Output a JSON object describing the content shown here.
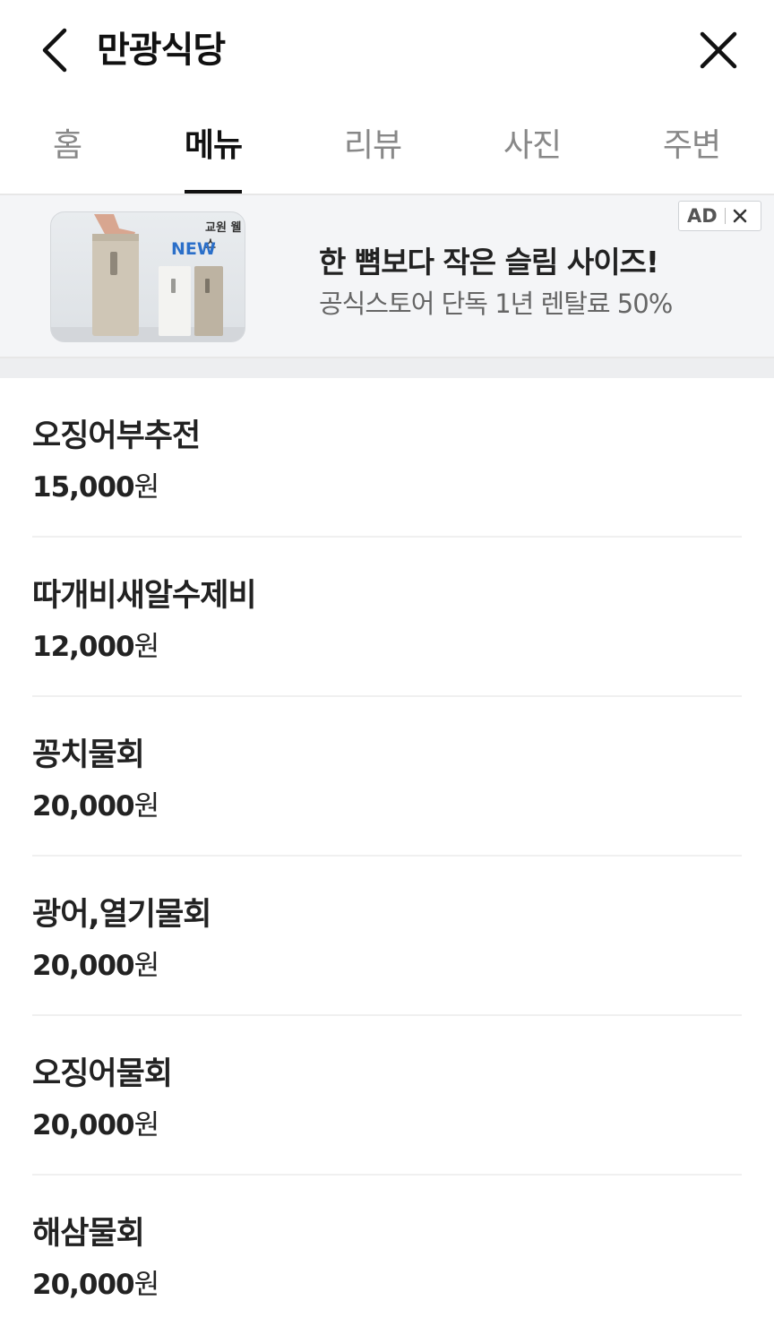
{
  "header": {
    "title": "만광식당",
    "back_icon": "chevron-left-icon",
    "close_icon": "close-icon"
  },
  "tabs": [
    {
      "label": "홈",
      "active": false
    },
    {
      "label": "메뉴",
      "active": true
    },
    {
      "label": "리뷰",
      "active": false
    },
    {
      "label": "사진",
      "active": false
    },
    {
      "label": "주변",
      "active": false
    }
  ],
  "ad": {
    "brand": "교원 웰스",
    "new_label": "NEW",
    "headline": "한 뼘보다 작은 슬림 사이즈!",
    "subtext": "공식스토어 단독 1년 렌탈료 50%",
    "badge": "AD"
  },
  "menu": [
    {
      "name": "오징어부추전",
      "price": "15,000",
      "unit": "원"
    },
    {
      "name": "따개비새알수제비",
      "price": "12,000",
      "unit": "원"
    },
    {
      "name": "꽁치물회",
      "price": "20,000",
      "unit": "원"
    },
    {
      "name": "광어,열기물회",
      "price": "20,000",
      "unit": "원"
    },
    {
      "name": "오징어물회",
      "price": "20,000",
      "unit": "원"
    },
    {
      "name": "해삼물회",
      "price": "20,000",
      "unit": "원"
    }
  ],
  "colors": {
    "accent": "#111111",
    "inactive_tab": "#888888",
    "ad_bg": "#f4f5f7",
    "ad_new": "#2b6fc9"
  }
}
